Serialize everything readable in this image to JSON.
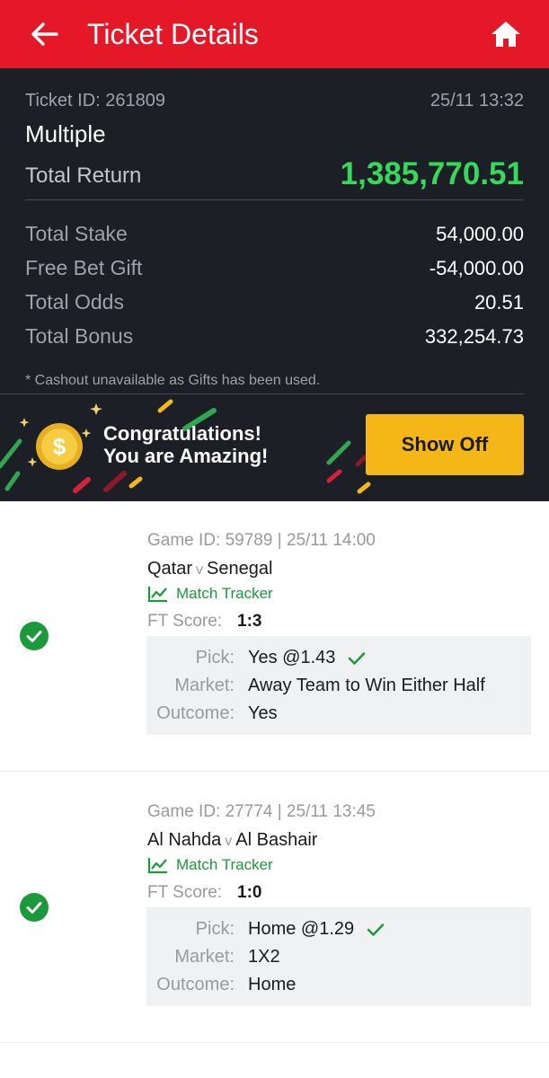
{
  "header": {
    "title": "Ticket Details",
    "back_icon": "arrow-left-icon",
    "home_icon": "home-icon"
  },
  "summary": {
    "ticket_id": "Ticket ID: 261809",
    "time": "25/11 13:32",
    "bet_type": "Multiple",
    "total_return_label": "Total Return",
    "total_return_value": "1,385,770.51",
    "rows": [
      {
        "label": "Total Stake",
        "value": "54,000.00"
      },
      {
        "label": "Free Bet Gift",
        "value": "-54,000.00"
      },
      {
        "label": "Total Odds",
        "value": "20.51"
      },
      {
        "label": "Total Bonus",
        "value": "332,254.73"
      }
    ],
    "note": "* Cashout unavailable as Gifts has been used."
  },
  "promo": {
    "line1": "Congratulations!",
    "line2": "You are Amazing!",
    "button_label": "Show Off",
    "coin_symbol": "$"
  },
  "selections": [
    {
      "game_id": "Game ID: 59789 | 25/11 14:00",
      "home": "Qatar",
      "vs": "v",
      "away": "Senegal",
      "tracker_label": "Match Tracker",
      "ft_label": "FT Score:",
      "ft_value": "1:3",
      "pick_label": "Pick:",
      "pick_value": "Yes @1.43",
      "market_label": "Market:",
      "market_value": "Away Team to Win Either Half",
      "outcome_label": "Outcome:",
      "outcome_value": "Yes"
    },
    {
      "game_id": "Game ID: 27774 | 25/11 13:45",
      "home": "Al Nahda",
      "vs": "v",
      "away": "Al Bashair",
      "tracker_label": "Match Tracker",
      "ft_label": "FT Score:",
      "ft_value": "1:0",
      "pick_label": "Pick:",
      "pick_value": "Home @1.29",
      "market_label": "Market:",
      "market_value": "1X2",
      "outcome_label": "Outcome:",
      "outcome_value": "Home"
    }
  ],
  "colors": {
    "header_red": "#e41827",
    "summary_bg": "#1d1f26",
    "return_green": "#35d95c",
    "button_yellow": "#f5b718",
    "won_green": "#1a9a3a"
  }
}
